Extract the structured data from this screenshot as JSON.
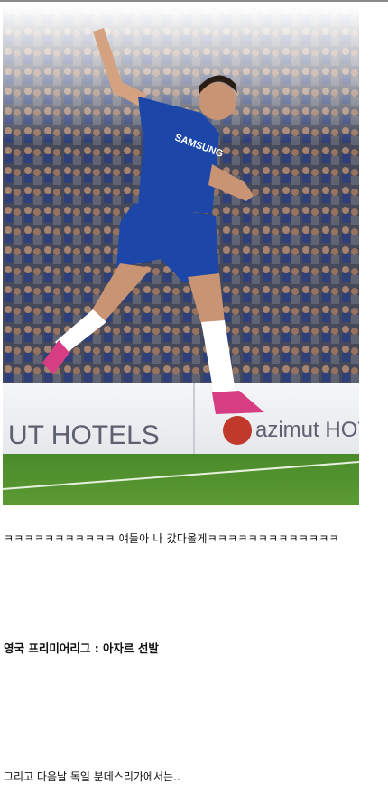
{
  "post": {
    "photo": {
      "description_icon": "celebrating-player-photo",
      "sponsor_board_left": "UT HOTELS",
      "sponsor_board_right": "azimut HOTE",
      "shirt_sponsor": "SAMSUNG"
    },
    "lines": [
      "ㅋㅋㅋㅋㅋㅋㅋㅋㅋㅋㅋ 얘들아 나 갔다올게ㅋㅋㅋㅋㅋㅋㅋㅋㅋㅋㅋㅋㅋ",
      "영국 프리미어리그 : 아자르 선발",
      "그리고 다음날 독일 분데스리가에서는.."
    ]
  },
  "colors": {
    "kit_blue": "#1c47a8",
    "pitch_green": "#4f8a2c",
    "board_white": "#f2f3f5",
    "crowd_dark": "#3a3f52"
  }
}
